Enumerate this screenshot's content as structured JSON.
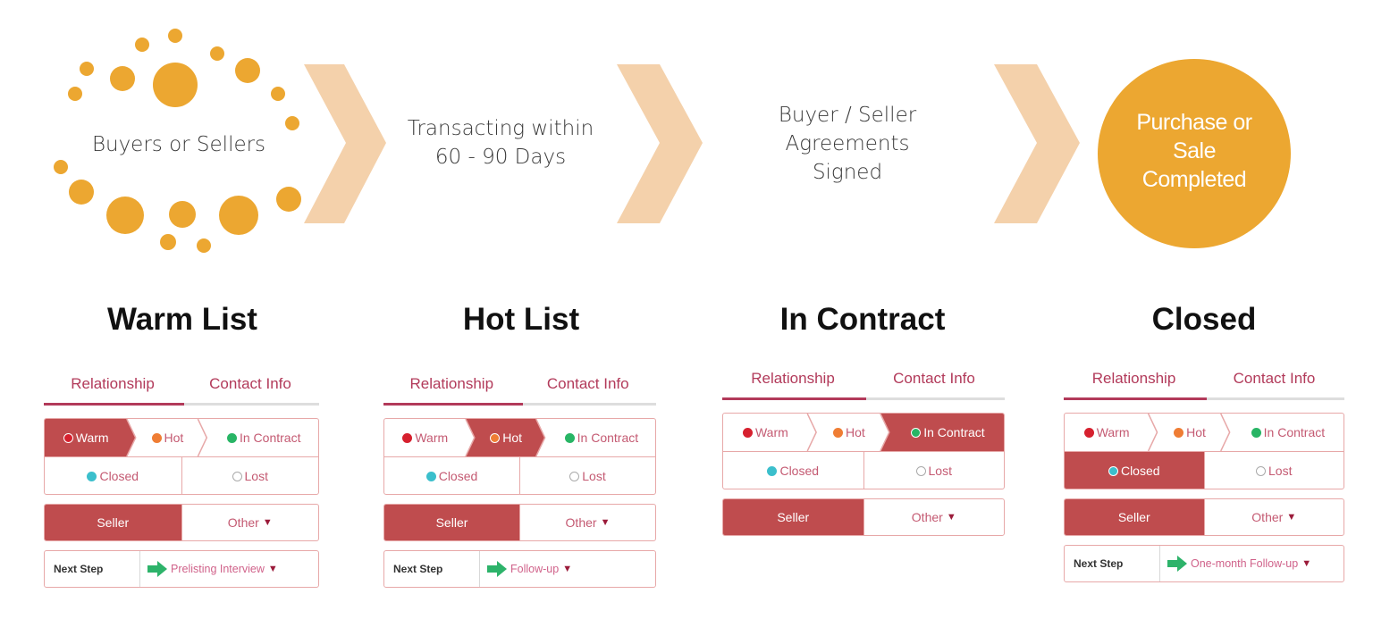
{
  "colors": {
    "orange": "#eca731",
    "chevron": "#f4d1ab",
    "accent": "#bf4c4e",
    "tab_text": "#b23a5a",
    "warm_dot": "#d6202e",
    "hot_dot": "#ef7d34",
    "contract_dot": "#28b565",
    "closed_dot": "#3bbfcc",
    "next_arrow": "#2db36a"
  },
  "flow": {
    "step1": "Buyers or Sellers",
    "step2_line1": "Transacting within",
    "step2_line2": "60 - 90 Days",
    "step3_line1": "Buyer / Seller",
    "step3_line2": "Agreements",
    "step3_line3": "Signed",
    "step4_line1": "Purchase or",
    "step4_line2": "Sale",
    "step4_line3": "Completed"
  },
  "cards": [
    {
      "title": "Warm List",
      "tabs": [
        "Relationship",
        "Contact Info"
      ],
      "stages": [
        "Warm",
        "Hot",
        "In Contract"
      ],
      "active_stage": "Warm",
      "statuses": [
        "Closed",
        "Lost"
      ],
      "active_status": null,
      "type_left": "Seller",
      "type_right": "Other",
      "next_step_label": "Next Step",
      "next_step_value": "Prelisting Interview"
    },
    {
      "title": "Hot List",
      "tabs": [
        "Relationship",
        "Contact Info"
      ],
      "stages": [
        "Warm",
        "Hot",
        "In Contract"
      ],
      "active_stage": "Hot",
      "statuses": [
        "Closed",
        "Lost"
      ],
      "active_status": null,
      "type_left": "Seller",
      "type_right": "Other",
      "next_step_label": "Next Step",
      "next_step_value": "Follow-up"
    },
    {
      "title": "In Contract",
      "tabs": [
        "Relationship",
        "Contact Info"
      ],
      "stages": [
        "Warm",
        "Hot",
        "In Contract"
      ],
      "active_stage": "In Contract",
      "statuses": [
        "Closed",
        "Lost"
      ],
      "active_status": null,
      "type_left": "Seller",
      "type_right": "Other",
      "next_step_label": null,
      "next_step_value": null
    },
    {
      "title": "Closed",
      "tabs": [
        "Relationship",
        "Contact Info"
      ],
      "stages": [
        "Warm",
        "Hot",
        "In Contract"
      ],
      "active_stage": null,
      "statuses": [
        "Closed",
        "Lost"
      ],
      "active_status": "Closed",
      "type_left": "Seller",
      "type_right": "Other",
      "next_step_label": "Next Step",
      "next_step_value": "One-month Follow-up"
    }
  ],
  "icons": {
    "caret": "▼",
    "arrow": "right-arrow"
  }
}
